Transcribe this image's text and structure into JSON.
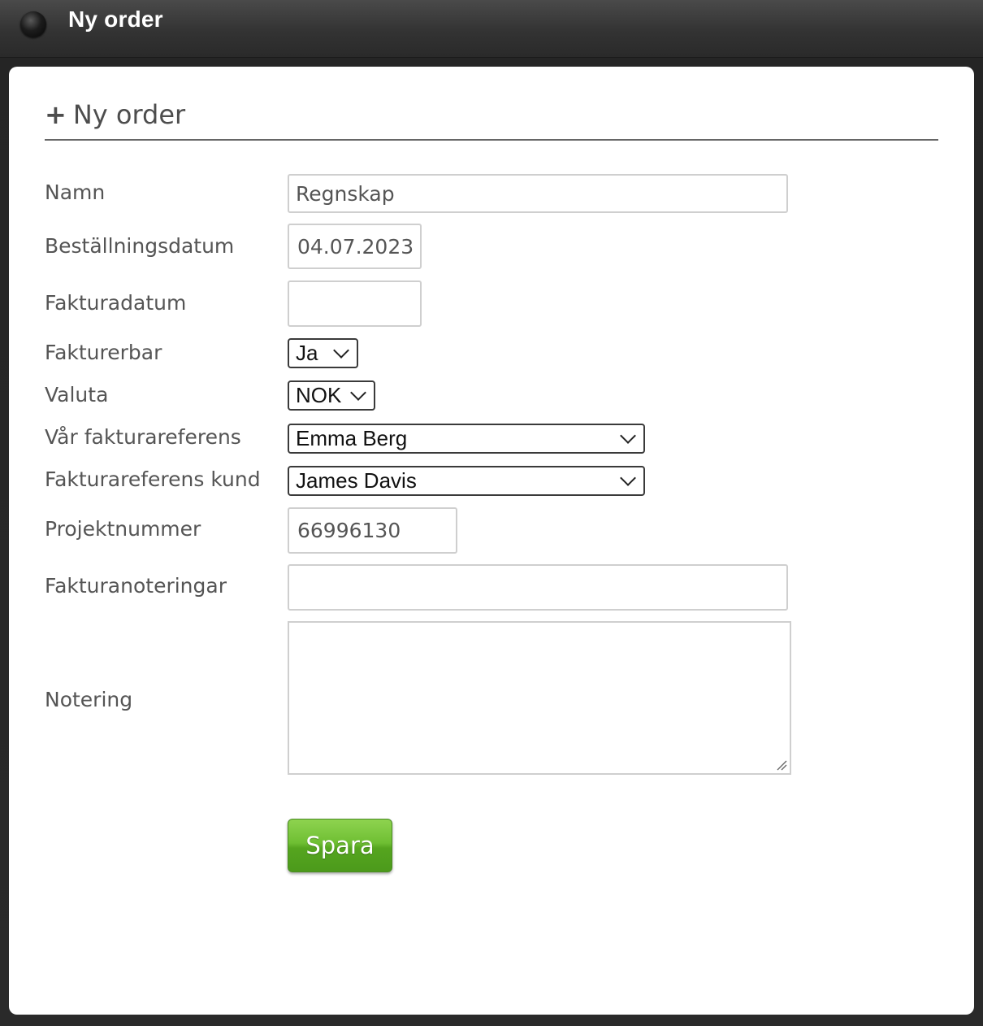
{
  "window": {
    "title": "Ny order"
  },
  "form": {
    "heading_icon": "+",
    "heading": "Ny order",
    "fields": {
      "namn": {
        "label": "Namn",
        "value": "Regnskap"
      },
      "bestallningsdatum": {
        "label": "Beställningsdatum",
        "value": "04.07.2023"
      },
      "fakturadatum": {
        "label": "Fakturadatum",
        "value": ""
      },
      "fakturerbar": {
        "label": "Fakturerbar",
        "value": "Ja"
      },
      "valuta": {
        "label": "Valuta",
        "value": "NOK"
      },
      "var_fakturareferens": {
        "label": "Vår fakturareferens",
        "value": "Emma Berg"
      },
      "fakturareferens_kund": {
        "label": "Fakturareferens kund",
        "value": "James Davis"
      },
      "projektnummer": {
        "label": "Projektnummer",
        "value": "66996130"
      },
      "fakturanoteringar": {
        "label": "Fakturanoteringar",
        "value": ""
      },
      "notering": {
        "label": "Notering",
        "value": ""
      }
    },
    "save_label": "Spara"
  },
  "colors": {
    "title_bar": "#333333",
    "save_button": "#5cb125",
    "label_text": "#555555"
  }
}
